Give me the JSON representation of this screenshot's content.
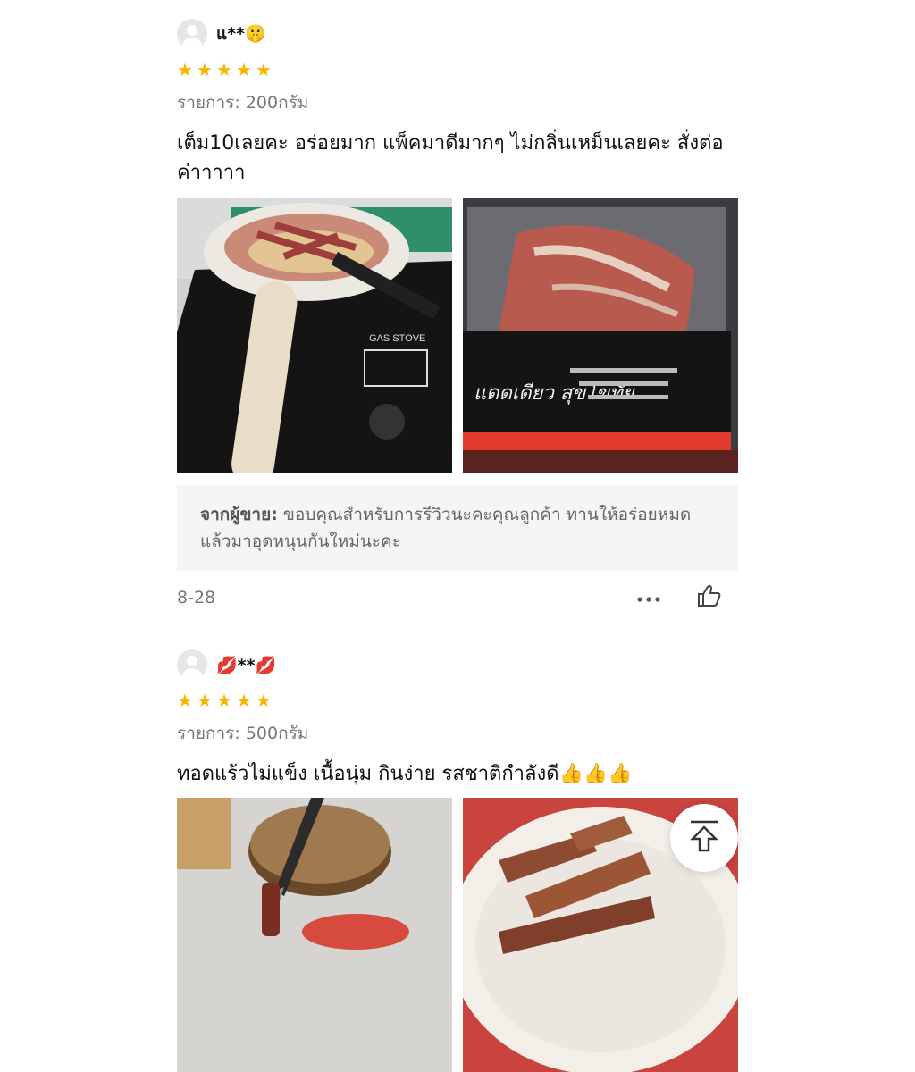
{
  "reviews": [
    {
      "username": "แ**🤫",
      "rating": 5,
      "variant": "รายการ: 200กรัม",
      "text": "เต็ม10เลยคะ อร่อยมาก แพ็คมาดีมากๆ ไม่กลิ่นเหม็นเลยคะ สั่งต่อค่าาาาา",
      "seller_label": "จากผู้ขาย:",
      "seller_reply": " ขอบคุณสำหรับการรีวิวนะคะคุณลูกค้า ทานให้อร่อยหมดแล้วมาอุดหนุนกันใหม่นะคะ",
      "date": "8-28",
      "package_text": "แดดเดียว สุขโขทัย"
    },
    {
      "username": "💋**💋",
      "rating": 5,
      "variant": "รายการ: 500กรัม",
      "text": "ทอดแร้วไม่แข็ง เนื้อนุ่ม กินง่าย รสชาติกำลังดี👍👍👍"
    }
  ],
  "icons": {
    "more": "more-icon",
    "like": "thumbs-up-icon",
    "back_to_top": "arrow-up-to-top-icon"
  },
  "colors": {
    "star": "#f7b500",
    "seller_bg": "#f5f5f5"
  }
}
